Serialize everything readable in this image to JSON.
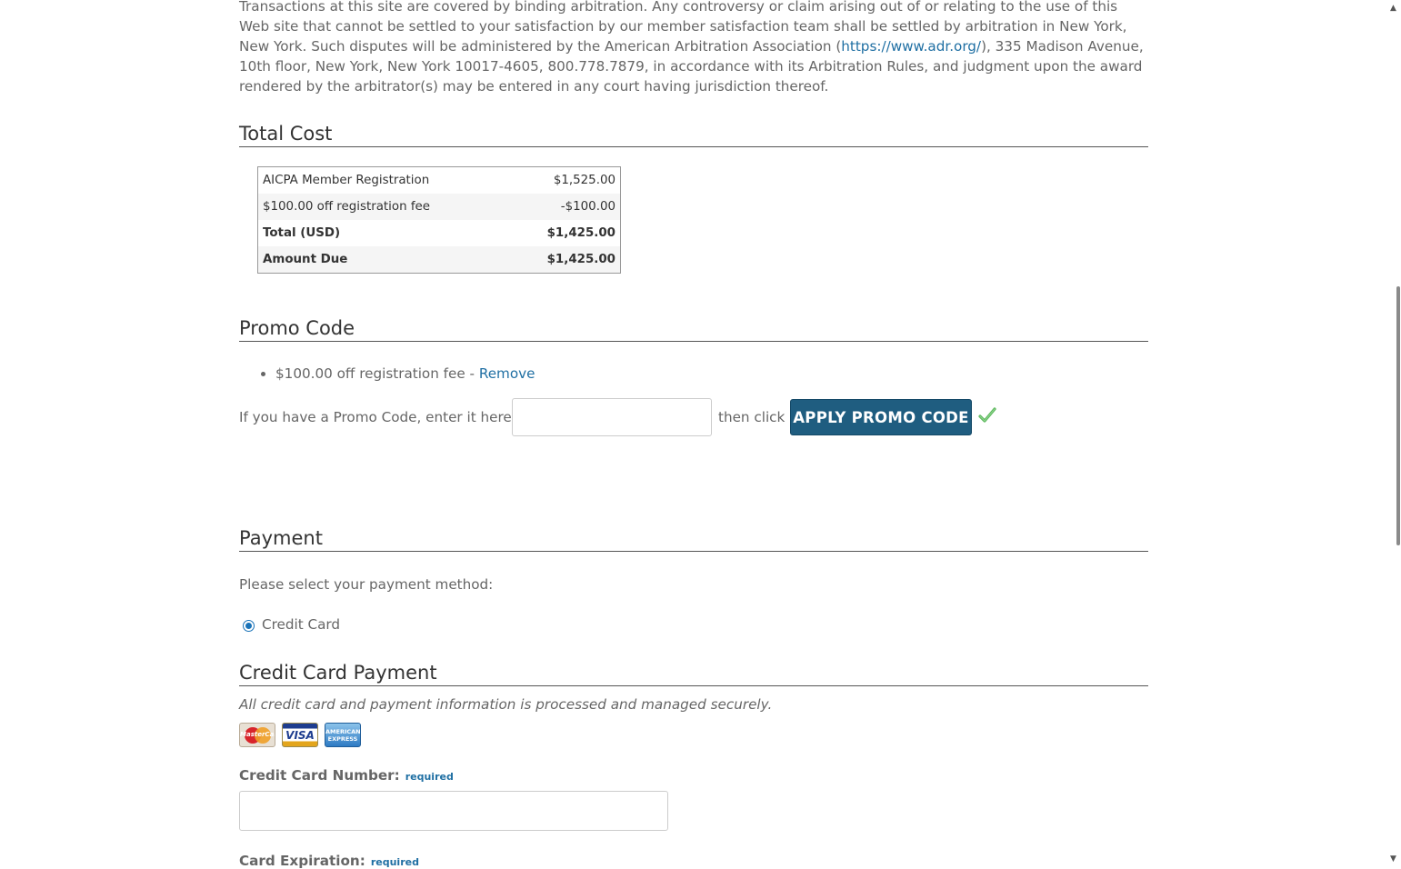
{
  "arbitration": {
    "text_before": "Transactions at this site are covered by binding arbitration. Any controversy or claim arising out of or relating to the use of this Web site that cannot be settled to your satisfaction by our member satisfaction team shall be settled by arbitration in New York, New York. Such disputes will be administered by the American Arbitration Association (",
    "link": "https://www.adr.org/",
    "text_after": "), 335 Madison Avenue, 10th floor, New York, New York 10017-4605, 800.778.7879, in accordance with its Arbitration Rules, and judgment upon the award rendered by the arbitrator(s) may be entered in any court having jurisdiction thereof."
  },
  "total_cost": {
    "title": "Total Cost",
    "rows": [
      {
        "label": "AICPA Member Registration",
        "amount": "$1,525.00"
      },
      {
        "label": "$100.00 off registration fee",
        "amount": "-$100.00"
      },
      {
        "label": "Total (USD)",
        "amount": "$1,425.00"
      },
      {
        "label": "Amount Due",
        "amount": "$1,425.00"
      }
    ]
  },
  "promo": {
    "title": "Promo Code",
    "applied_item": "$100.00 off registration fee - ",
    "remove_label": "Remove",
    "enter_label": "If you have a Promo Code, enter it here:",
    "input_value": "",
    "then_label": "then click",
    "apply_label": "APPLY PROMO CODE"
  },
  "payment": {
    "title": "Payment",
    "select_text": "Please select your payment method:",
    "method_label": "Credit Card"
  },
  "credit_card": {
    "title": "Credit Card Payment",
    "secure_text": "All credit card and payment information is processed and managed securely.",
    "cards": [
      "MasterCard",
      "VISA",
      "AMERICAN EXPRESS"
    ],
    "number_label": "Credit Card Number:",
    "required_label": "required",
    "expiration_label": "Card Expiration:",
    "number_value": ""
  },
  "colors": {
    "accent": "#1f5d80",
    "link": "#1f6fa3",
    "check": "#5cb85c"
  }
}
